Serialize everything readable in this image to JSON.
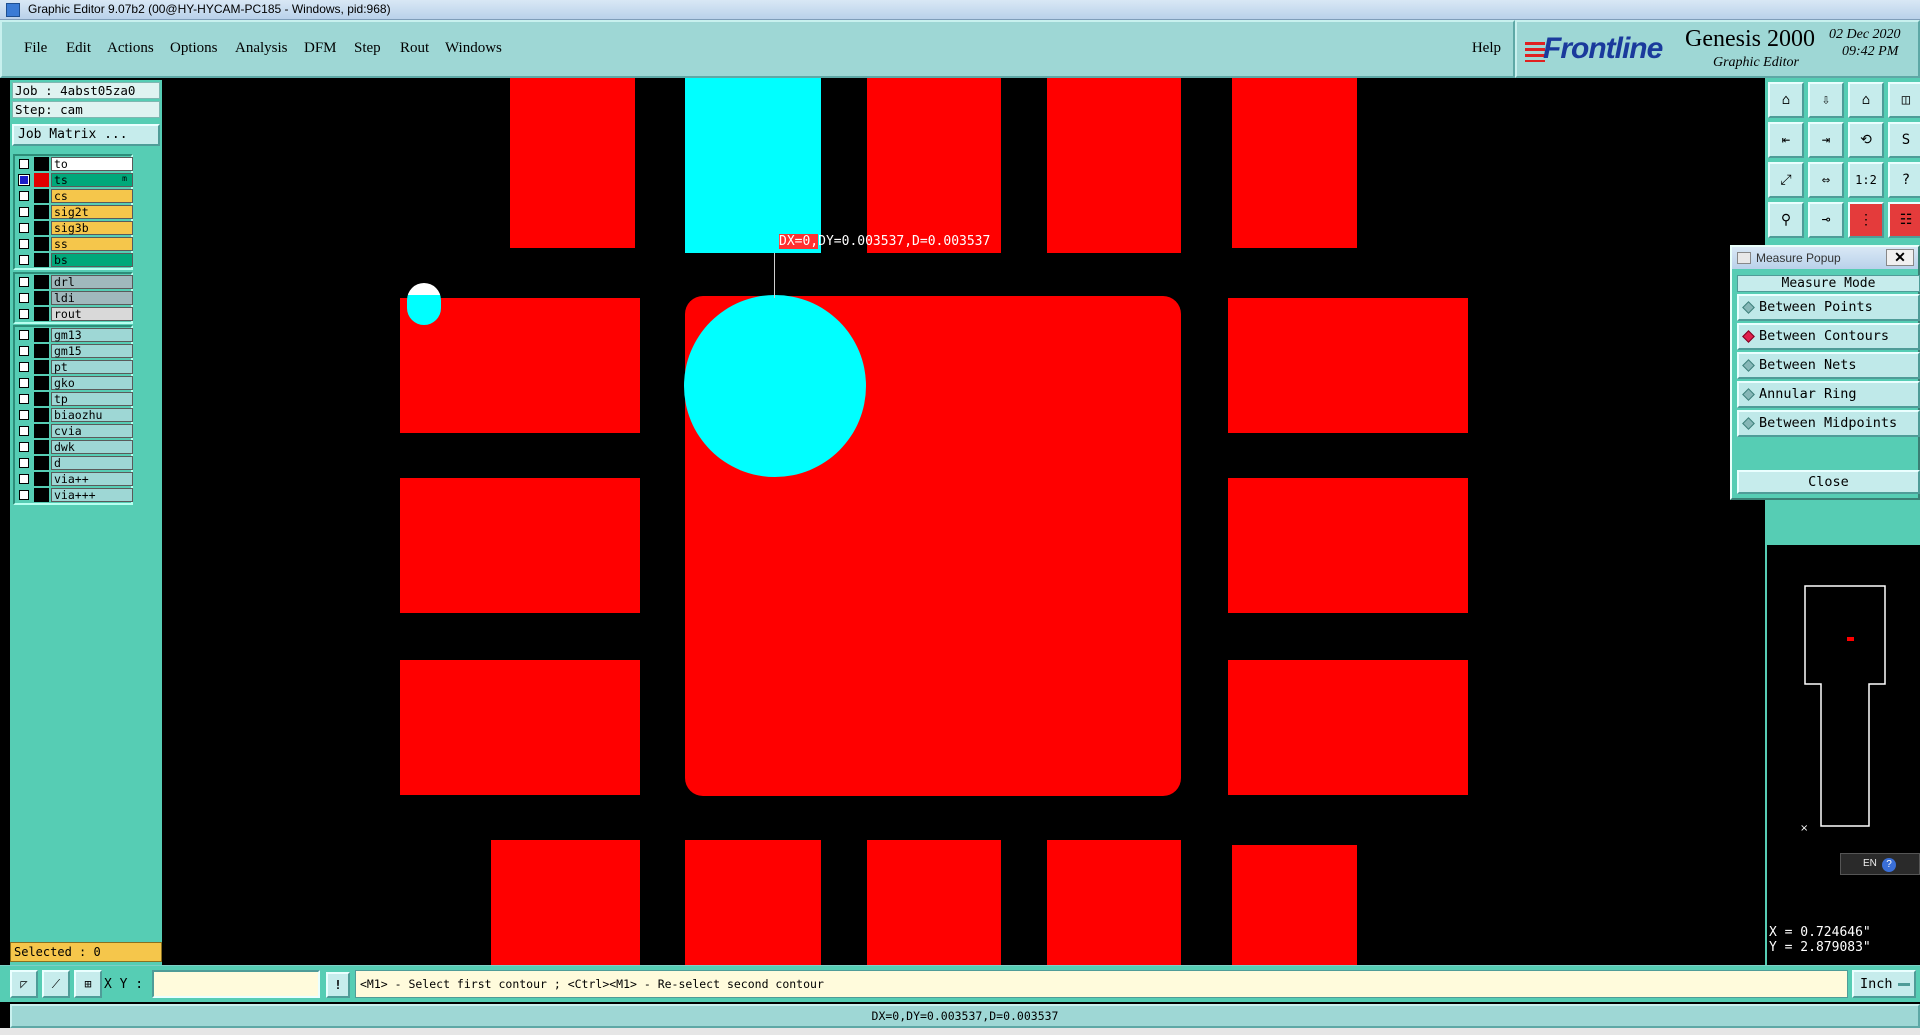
{
  "window": {
    "title": "Graphic Editor 9.07b2 (00@HY-HYCAM-PC185 - Windows, pid:968)"
  },
  "menu": {
    "items": [
      "File",
      "Edit",
      "Actions",
      "Options",
      "Analysis",
      "DFM",
      "Step",
      "Rout",
      "Windows"
    ],
    "help": "Help"
  },
  "logo": {
    "brand": "Frontline",
    "product": "Genesis 2000",
    "subtitle": "Graphic Editor",
    "date": "02 Dec 2020",
    "time": "09:42 PM"
  },
  "left_panel": {
    "job": "Job : 4abst05za0",
    "step": "Step: cam",
    "job_matrix": "Job Matrix ...",
    "layer_groups": [
      [
        {
          "name": "to",
          "bg": "#ffffff",
          "checked": false,
          "swatch": "black"
        },
        {
          "name": "ts",
          "bg": "#00a87a",
          "checked": true,
          "swatch": "red",
          "tag": "m"
        },
        {
          "name": "cs",
          "bg": "#f5c64b",
          "checked": false,
          "swatch": "black"
        },
        {
          "name": "sig2t",
          "bg": "#f5c64b",
          "checked": false,
          "swatch": "black"
        },
        {
          "name": "sig3b",
          "bg": "#f5c64b",
          "checked": false,
          "swatch": "black"
        },
        {
          "name": "ss",
          "bg": "#f5c64b",
          "checked": false,
          "swatch": "black"
        },
        {
          "name": "bs",
          "bg": "#00a87a",
          "checked": false,
          "swatch": "black"
        }
      ],
      [
        {
          "name": "drl",
          "bg": "#a0b8bc",
          "checked": false,
          "swatch": "black"
        },
        {
          "name": "ldi",
          "bg": "#a0b8bc",
          "checked": false,
          "swatch": "black"
        },
        {
          "name": "rout",
          "bg": "#d9d9d9",
          "checked": false,
          "swatch": "black"
        }
      ],
      [
        {
          "name": "gm13",
          "bg": "#9ed7d5",
          "checked": false,
          "swatch": "black"
        },
        {
          "name": "gm15",
          "bg": "#9ed7d5",
          "checked": false,
          "swatch": "black"
        },
        {
          "name": "pt",
          "bg": "#9ed7d5",
          "checked": false,
          "swatch": "black"
        },
        {
          "name": "gko",
          "bg": "#9ed7d5",
          "checked": false,
          "swatch": "black"
        },
        {
          "name": "tp",
          "bg": "#9ed7d5",
          "checked": false,
          "swatch": "black"
        },
        {
          "name": "biaozhu",
          "bg": "#9ed7d5",
          "checked": false,
          "swatch": "black"
        },
        {
          "name": "cvia",
          "bg": "#9ed7d5",
          "checked": false,
          "swatch": "black"
        },
        {
          "name": "dwk",
          "bg": "#9ed7d5",
          "checked": false,
          "swatch": "black"
        },
        {
          "name": "d",
          "bg": "#9ed7d5",
          "checked": false,
          "swatch": "black"
        },
        {
          "name": "via++",
          "bg": "#9ed7d5",
          "checked": false,
          "swatch": "black"
        },
        {
          "name": "via+++",
          "bg": "#9ed7d5",
          "checked": false,
          "swatch": "black"
        }
      ]
    ],
    "selected": "Selected : 0"
  },
  "canvas": {
    "measure_label_prefix": "DX=0,",
    "measure_label_rest": "DY=0.003537,D=0.003537"
  },
  "toolbar": {
    "buttons": [
      {
        "icon": "zoom-home-icon",
        "glyph": "⌂"
      },
      {
        "icon": "zoom-prev-icon",
        "glyph": "⇩"
      },
      {
        "icon": "home-icon",
        "glyph": "⌂"
      },
      {
        "icon": "panel-icon",
        "glyph": "◫"
      },
      {
        "icon": "pan-left-icon",
        "glyph": "⇤"
      },
      {
        "icon": "pan-right-icon",
        "glyph": "⇥"
      },
      {
        "icon": "redraw-icon",
        "glyph": "⟲"
      },
      {
        "icon": "snap-icon",
        "glyph": "S"
      },
      {
        "icon": "fit-screen-icon",
        "glyph": "⤢"
      },
      {
        "icon": "fit-width-icon",
        "glyph": "⇔"
      },
      {
        "icon": "scale-icon",
        "glyph": "1:2"
      },
      {
        "icon": "help-icon",
        "glyph": "?"
      },
      {
        "icon": "measure-icon",
        "glyph": "⚲"
      },
      {
        "icon": "probe-icon",
        "glyph": "⊸"
      },
      {
        "icon": "net-icon",
        "glyph": "⋮"
      },
      {
        "icon": "layers-icon",
        "glyph": "☷"
      }
    ]
  },
  "measure_popup": {
    "title": "Measure Popup",
    "close_x": "✕",
    "mode_header": "Measure Mode",
    "modes": [
      "Between Points",
      "Between Contours",
      "Between Nets",
      "Annular Ring",
      "Between Midpoints"
    ],
    "selected_mode": "Between Contours",
    "close_label": "Close"
  },
  "ime": {
    "lang": "EN",
    "help": "?"
  },
  "coords": {
    "x": "X = 0.724646\"",
    "y": "Y = 2.879083\""
  },
  "command_bar": {
    "xy_label": "X Y :",
    "xy_value": "",
    "excl": "!",
    "prompt": "<M1> - Select first contour ; <Ctrl><M1> - Re-select second contour",
    "units": "Inch"
  },
  "status": {
    "text": "DX=0,DY=0.003537,D=0.003537"
  },
  "colors": {
    "pad": "#ff0000",
    "selected": "#00ffff",
    "panel": "#56cdb4",
    "menu": "#9ed7d5"
  }
}
